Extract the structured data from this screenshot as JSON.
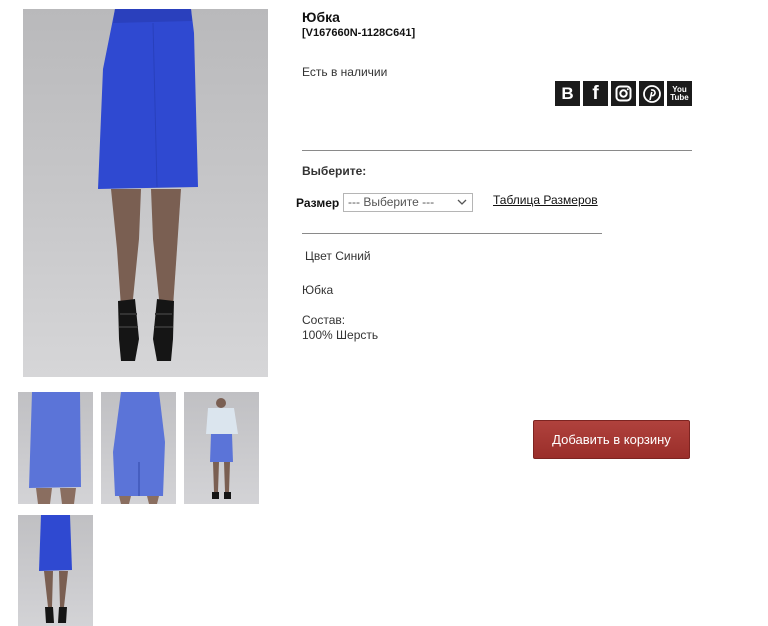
{
  "product": {
    "title": "Юбка",
    "sku": "[V167660N-1128C641]",
    "availability": "Есть в наличии",
    "description": "Юбка",
    "color_line": "Цвет Синий",
    "composition_label": "Состав:",
    "composition_value": "100% Шерсть",
    "skirt_color": "#2f49d1",
    "thumb_skirt_color": "#5b74d8"
  },
  "social": {
    "vk_label": "В",
    "fb_label": "f",
    "yt_label_top": "You",
    "yt_label_bottom": "Tube",
    "icons": [
      "vk-icon",
      "facebook-icon",
      "instagram-icon",
      "pinterest-icon",
      "youtube-icon"
    ]
  },
  "options": {
    "choose_label": "Выберите:",
    "size_label": "Размер",
    "size_selected": "--- Выберите ---",
    "size_table_link": "Таблица Размеров"
  },
  "cart": {
    "add_label": "Добавить в корзину",
    "button_color": "#a3332f"
  }
}
